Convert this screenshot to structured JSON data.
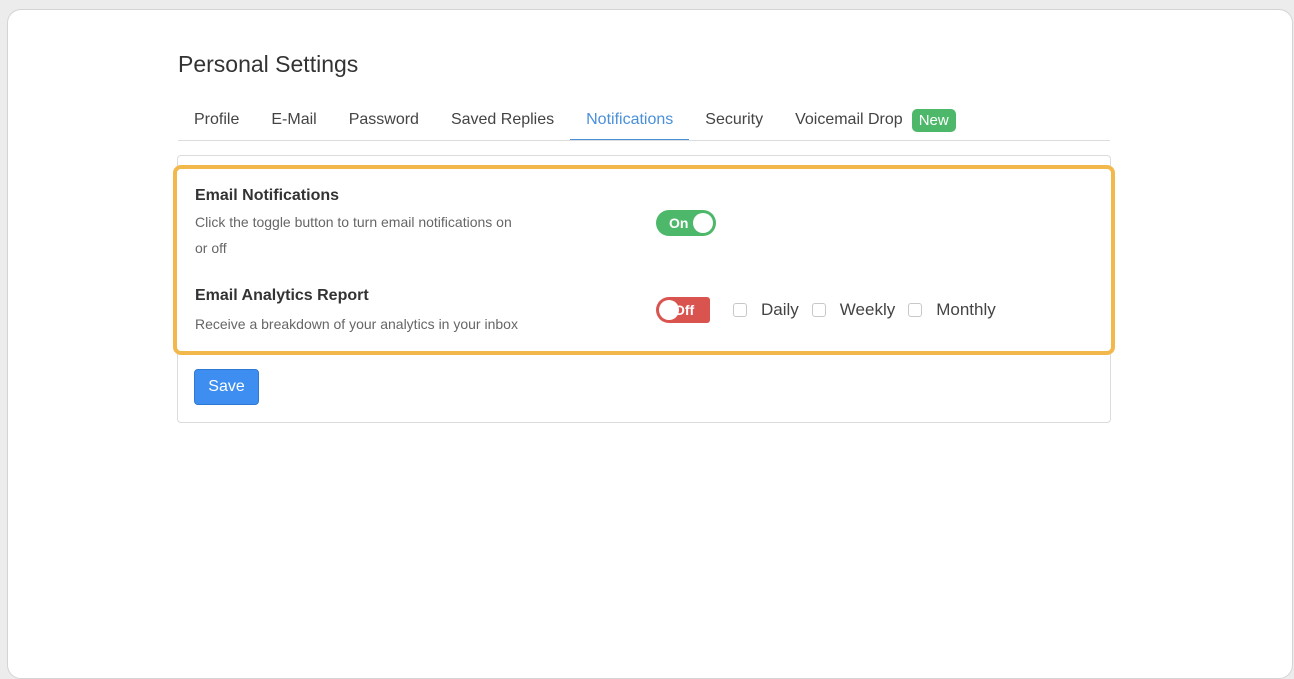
{
  "page": {
    "title": "Personal Settings"
  },
  "tabs": [
    {
      "label": "Profile",
      "active": false
    },
    {
      "label": "E-Mail",
      "active": false
    },
    {
      "label": "Password",
      "active": false
    },
    {
      "label": "Saved Replies",
      "active": false
    },
    {
      "label": "Notifications",
      "active": true
    },
    {
      "label": "Security",
      "active": false
    },
    {
      "label": "Voicemail Drop",
      "active": false,
      "badge": "New"
    }
  ],
  "notifications": {
    "email": {
      "title": "Email Notifications",
      "description_line1": "Click the toggle button to turn email notifications on",
      "description_line2": "or off",
      "toggle_label": "On",
      "toggle_state": true
    },
    "analytics": {
      "title": "Email Analytics Report",
      "description": "Receive a breakdown of your analytics in your inbox",
      "toggle_label": "Off",
      "toggle_state": false,
      "frequency_options": [
        {
          "label": "Daily",
          "checked": false
        },
        {
          "label": "Weekly",
          "checked": false
        },
        {
          "label": "Monthly",
          "checked": false
        }
      ]
    }
  },
  "actions": {
    "save_label": "Save"
  },
  "colors": {
    "accent": "#4a90d9",
    "toggle_on": "#4db86a",
    "toggle_off": "#d9534f",
    "highlight": "#f2b84b",
    "save_button": "#3d8ef0",
    "badge": "#4db86a"
  }
}
